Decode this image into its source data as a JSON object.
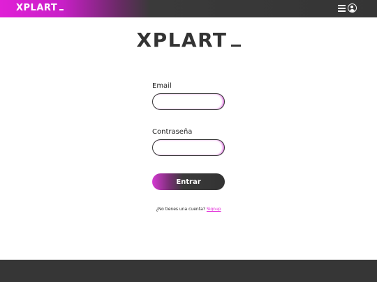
{
  "header": {
    "logo_text": "XPLART",
    "menu_icon": "hamburger-menu-icon",
    "user_icon": "user-account-icon"
  },
  "main": {
    "logo_text": "XPLART",
    "email_label": "Email",
    "email_value": "",
    "password_label": "Contraseña",
    "password_value": "",
    "submit_label": "Entrar",
    "signup_prompt": "¿No tienes una cuenta?",
    "signup_link": "Signup"
  },
  "colors": {
    "accent": "#e020d6",
    "dark": "#353535",
    "background": "#ffffff"
  }
}
